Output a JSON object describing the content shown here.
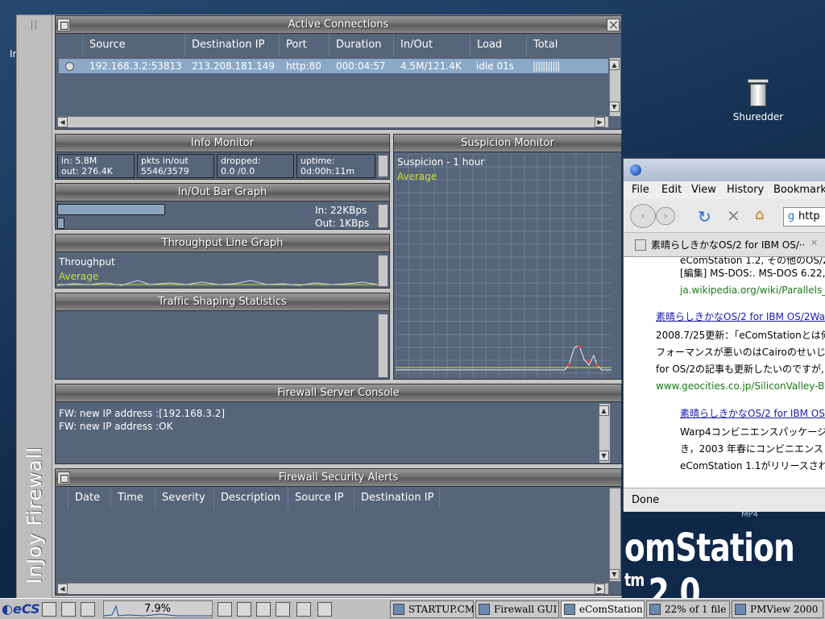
{
  "desktop": {
    "left_label": "In",
    "trash_label": "Shuredder",
    "brand_text": "omStation",
    "brand_version": "2.0",
    "brand_small": "MP4"
  },
  "window": {
    "vertical_title": "InJoy Firewall"
  },
  "active": {
    "title": "Active Connections",
    "columns": [
      "Source",
      "Destination IP",
      "Port",
      "Duration",
      "In/Out",
      "Load",
      "Total"
    ],
    "row": {
      "source": "192.168.3.2:53813",
      "dest": "213.208.181.149",
      "port": "http:80",
      "duration": "000:04:57",
      "inout": "4.5M/121.4K",
      "load": "idle 01s",
      "total": "|||||||||||"
    }
  },
  "info": {
    "title": "Info Monitor",
    "in": "in: 5.8M",
    "out": "out: 276.4K",
    "pkts_label": "pkts in/out",
    "pkts_value": "5546/3579",
    "dropped_label": "dropped:",
    "dropped_value": "0.0 /0.0",
    "uptime_label": "uptime:",
    "uptime_value": "0d:00h:11m"
  },
  "bar": {
    "title": "In/Out Bar Graph",
    "in": "In: 22KBps",
    "out": "Out: 1KBps",
    "in_fill": 0.45,
    "out_fill": 0.03
  },
  "throughput": {
    "title": "Throughput Line Graph",
    "label": "Throughput",
    "avg": "Average"
  },
  "shaping": {
    "title": "Traffic Shaping Statistics"
  },
  "suspicion": {
    "title": "Suspicion Monitor",
    "label": "Suspicion - 1 hour",
    "avg": "Average"
  },
  "console": {
    "title": "Firewall Server Console",
    "lines": [
      "FW: new IP address :[192.168.3.2]",
      "FW: new IP address :OK"
    ]
  },
  "alerts": {
    "title": "Firewall Security Alerts",
    "columns": [
      "Date",
      "Time",
      "Severity",
      "Description",
      "Source IP",
      "Destination IP"
    ]
  },
  "browser": {
    "menu": [
      "File",
      "Edit",
      "View",
      "History",
      "Bookmarks"
    ],
    "url": "http",
    "tab": "素晴らしきかなOS/2 for IBM OS/···",
    "status": "Done",
    "lines": [
      "eComStation 1.2, その他のOS/2",
      "[編集] MS-DOS:. MS-DOS 6.22,",
      "ja.wikipedia.org/wiki/Parallels_",
      "素晴らしきかなOS/2 for IBM OS/2Wa",
      "2008.7/25更新：「eComStationとは何",
      "フォーマンスが悪いのはCairoのせいじ",
      "for OS/2の記事も更新したいのですが,",
      "www.geocities.co.jp/SiliconValley-Ba",
      "素晴らしきかなOS/2 for IBM OS/",
      "Warp4コンビニエンスパッケージ",
      "き，2003 年春にコンビニエンス",
      "eComStation 1.1がリリースされ"
    ]
  },
  "taskbar": {
    "cpu": "7.9%",
    "items": [
      "STARTUP.CMD",
      "Firewall GUI",
      "eComStation -",
      "22% of 1 file -",
      "PMView 2000"
    ]
  },
  "colors": {
    "panel": "#56657a",
    "selected_row": "#8ba9c7",
    "average": "#c8e030",
    "link": "#1a1ab0",
    "url_green": "#1a7a1a"
  }
}
